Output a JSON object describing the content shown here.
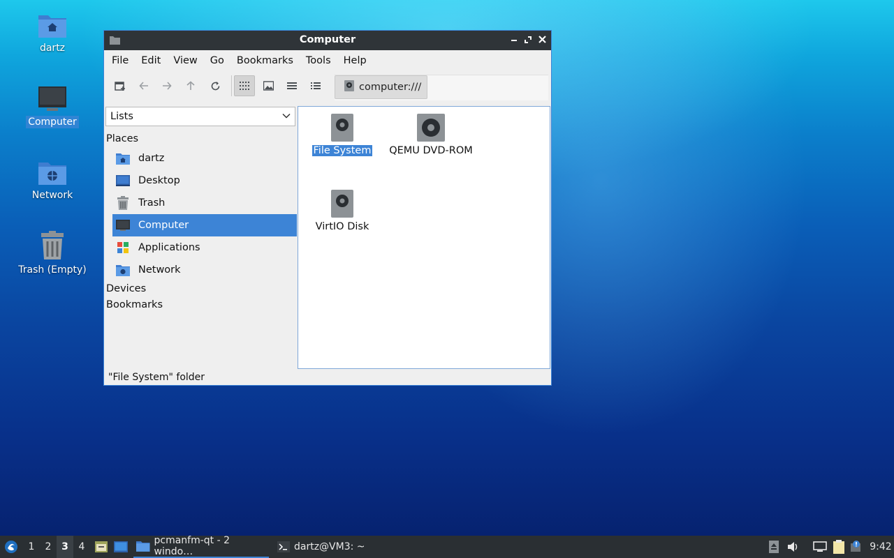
{
  "desktop": {
    "icons": [
      {
        "label": "dartz",
        "icon": "home-folder-icon"
      },
      {
        "label": "Computer",
        "icon": "computer-icon"
      },
      {
        "label": "Network",
        "icon": "network-folder-icon"
      },
      {
        "label": "Trash (Empty)",
        "icon": "trash-icon"
      }
    ]
  },
  "window": {
    "title": "Computer",
    "menu": [
      "File",
      "Edit",
      "View",
      "Go",
      "Bookmarks",
      "Tools",
      "Help"
    ],
    "path": "computer:///",
    "sidebar": {
      "mode": "Lists",
      "sections": {
        "places": "Places",
        "devices": "Devices",
        "bookmarks": "Bookmarks"
      },
      "places": [
        {
          "label": "dartz",
          "icon": "home-folder-icon"
        },
        {
          "label": "Desktop",
          "icon": "desktop-icon"
        },
        {
          "label": "Trash",
          "icon": "trash-icon"
        },
        {
          "label": "Computer",
          "icon": "computer-icon",
          "selected": true
        },
        {
          "label": "Applications",
          "icon": "applications-icon"
        },
        {
          "label": "Network",
          "icon": "network-folder-icon"
        }
      ]
    },
    "items": [
      {
        "label": "File System",
        "icon": "hard-disk-icon",
        "selected": true
      },
      {
        "label": "QEMU DVD-ROM",
        "icon": "optical-drive-icon"
      },
      {
        "label": "VirtIO Disk",
        "icon": "hard-disk-icon"
      }
    ],
    "status": "\"File System\" folder"
  },
  "taskbar": {
    "workspaces": [
      "1",
      "2",
      "3",
      "4"
    ],
    "active_workspace": "3",
    "tasks": [
      {
        "label": "pcmanfm-qt - 2 windo…",
        "icon": "folder-icon",
        "active": true
      },
      {
        "label": "dartz@VM3: ~",
        "icon": "terminal-icon"
      }
    ],
    "clock": "9:42"
  },
  "colors": {
    "accent": "#3d84d6",
    "titlebar": "#2f3438",
    "taskbar": "#2a2f33"
  }
}
